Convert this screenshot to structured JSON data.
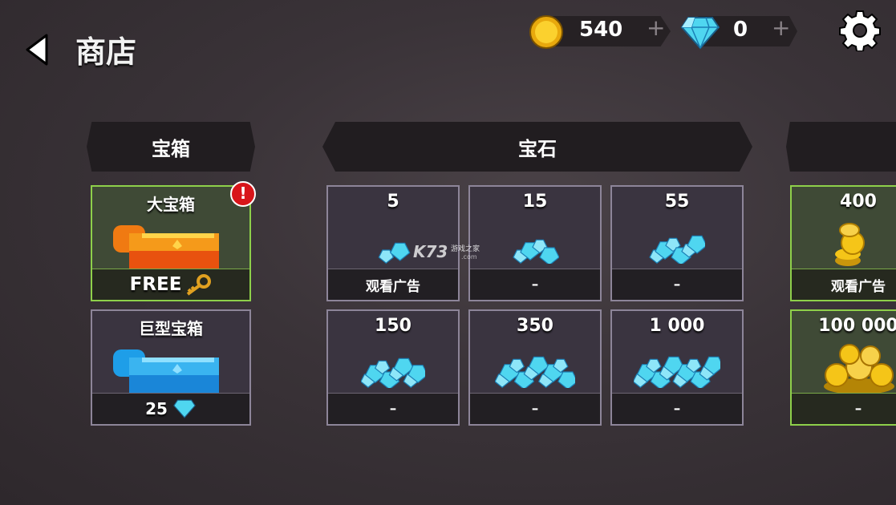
{
  "header": {
    "title": "商店"
  },
  "currency": {
    "coins": {
      "value": "540",
      "plus": "+"
    },
    "gems": {
      "value": "0",
      "plus": "+"
    }
  },
  "sections": {
    "chests": "宝箱",
    "gems": "宝石",
    "coins": ""
  },
  "chests": [
    {
      "title": "大宝箱",
      "price": "FREE",
      "alert": "!"
    },
    {
      "title": "巨型宝箱",
      "price": "25"
    }
  ],
  "gem_packs": [
    {
      "amount": "5",
      "price": "观看广告"
    },
    {
      "amount": "15",
      "price": "–"
    },
    {
      "amount": "55",
      "price": "–"
    },
    {
      "amount": "150",
      "price": "–"
    },
    {
      "amount": "350",
      "price": "–"
    },
    {
      "amount": "1 000",
      "price": "–"
    }
  ],
  "coin_packs": [
    {
      "amount": "400",
      "price": "观看广告"
    },
    {
      "amount": "100 000",
      "price": "–"
    }
  ],
  "watermark": {
    "brand": "K73",
    "sub": "游戏之家",
    "domain": ".com"
  },
  "colors": {
    "coin": "#f5c518",
    "gem": "#4fd6f0",
    "green_border": "#8ed04a",
    "alert_red": "#d8151a"
  },
  "icons": [
    "back-arrow-icon",
    "coin-icon",
    "gem-icon",
    "settings-gear-icon",
    "key-icon"
  ]
}
